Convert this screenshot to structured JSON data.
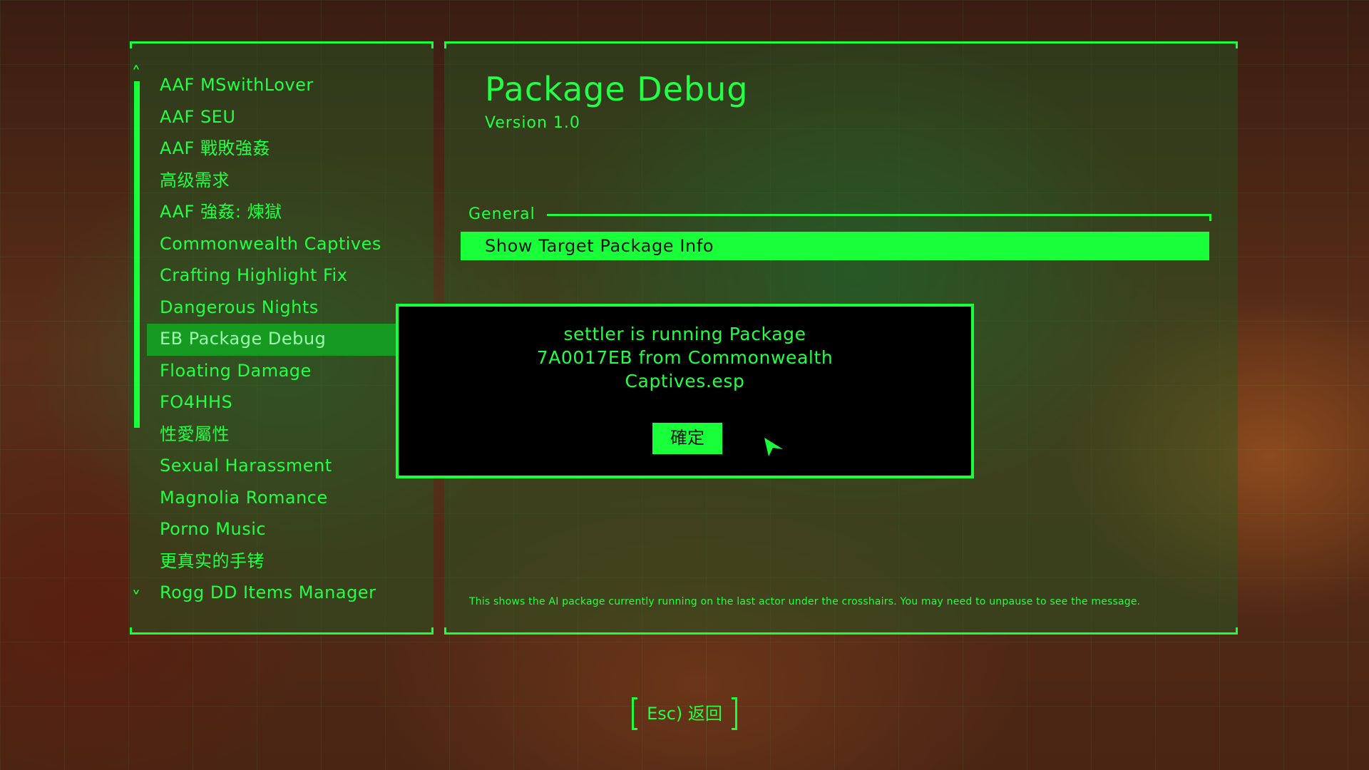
{
  "mod_list": {
    "items": [
      "AAF MSwithLover",
      "AAF SEU",
      "AAF 戰敗強姦",
      "高级需求",
      "AAF 強姦: 煉獄",
      "Commonwealth Captives",
      "Crafting Highlight Fix",
      "Dangerous Nights",
      "EB Package Debug",
      "Floating Damage",
      "FO4HHS",
      "性愛屬性",
      "Sexual Harassment",
      "Magnolia Romance",
      "Porno Music",
      "更真实的手铐",
      "Rogg DD Items Manager"
    ],
    "selected_index": 8,
    "scroll_up_icon": "chevron-up-icon",
    "scroll_down_icon": "chevron-down-icon"
  },
  "page": {
    "title": "Package Debug",
    "version": "Version 1.0",
    "section": "General",
    "option": "Show Target Package Info",
    "help": "This shows the AI package currently running on the last actor under the crosshairs. You may need to unpause to see the message."
  },
  "dialog": {
    "lines": [
      "settler is running Package",
      "7A0017EB from Commonwealth",
      "Captives.esp"
    ],
    "ok_label": "確定"
  },
  "footer": {
    "back_label": "Esc) 返回"
  },
  "colors": {
    "accent": "#19ff3a",
    "selected_bg": "#169a22"
  }
}
